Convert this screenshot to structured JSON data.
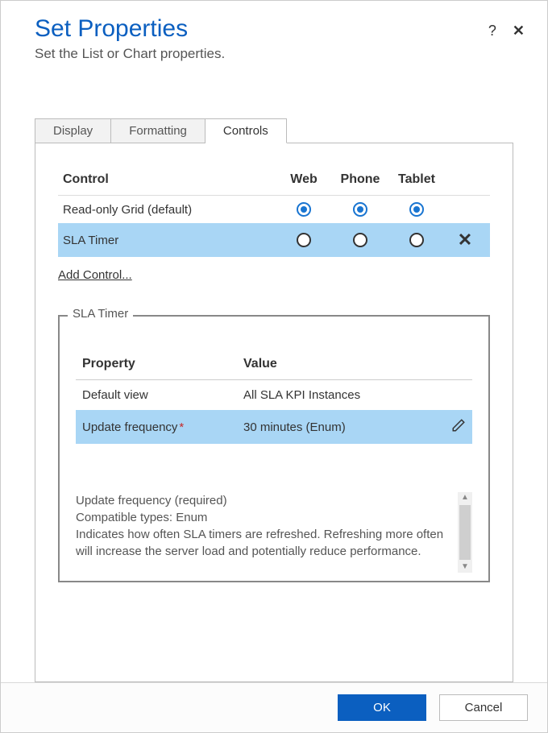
{
  "header": {
    "title": "Set Properties",
    "subtitle": "Set the List or Chart properties."
  },
  "tabs": {
    "items": [
      {
        "label": "Display",
        "active": false
      },
      {
        "label": "Formatting",
        "active": false
      },
      {
        "label": "Controls",
        "active": true
      }
    ]
  },
  "control_table": {
    "headers": {
      "control": "Control",
      "web": "Web",
      "phone": "Phone",
      "tablet": "Tablet"
    },
    "rows": [
      {
        "name": "Read-only Grid (default)",
        "web": true,
        "phone": true,
        "tablet": true,
        "removable": false,
        "selected": false
      },
      {
        "name": "SLA Timer",
        "web": false,
        "phone": false,
        "tablet": false,
        "removable": true,
        "selected": true
      }
    ],
    "add_label": "Add Control..."
  },
  "fieldset": {
    "legend": "SLA Timer",
    "prop_header": {
      "property": "Property",
      "value": "Value"
    },
    "rows": [
      {
        "name": "Default view",
        "required": false,
        "value": "All SLA KPI Instances",
        "selected": false,
        "editable": false
      },
      {
        "name": "Update frequency",
        "required": true,
        "value": "30 minutes (Enum)",
        "selected": true,
        "editable": true
      }
    ],
    "description": {
      "line1": "Update frequency (required)",
      "line2": "Compatible types: Enum",
      "body": "Indicates how often SLA timers are refreshed. Refreshing more often will increase the server load and potentially reduce performance."
    }
  },
  "footer": {
    "ok": "OK",
    "cancel": "Cancel"
  },
  "icons": {
    "help": "?",
    "close": "✕",
    "delete": "✕",
    "edit": "✎",
    "up": "▲",
    "down": "▼"
  }
}
